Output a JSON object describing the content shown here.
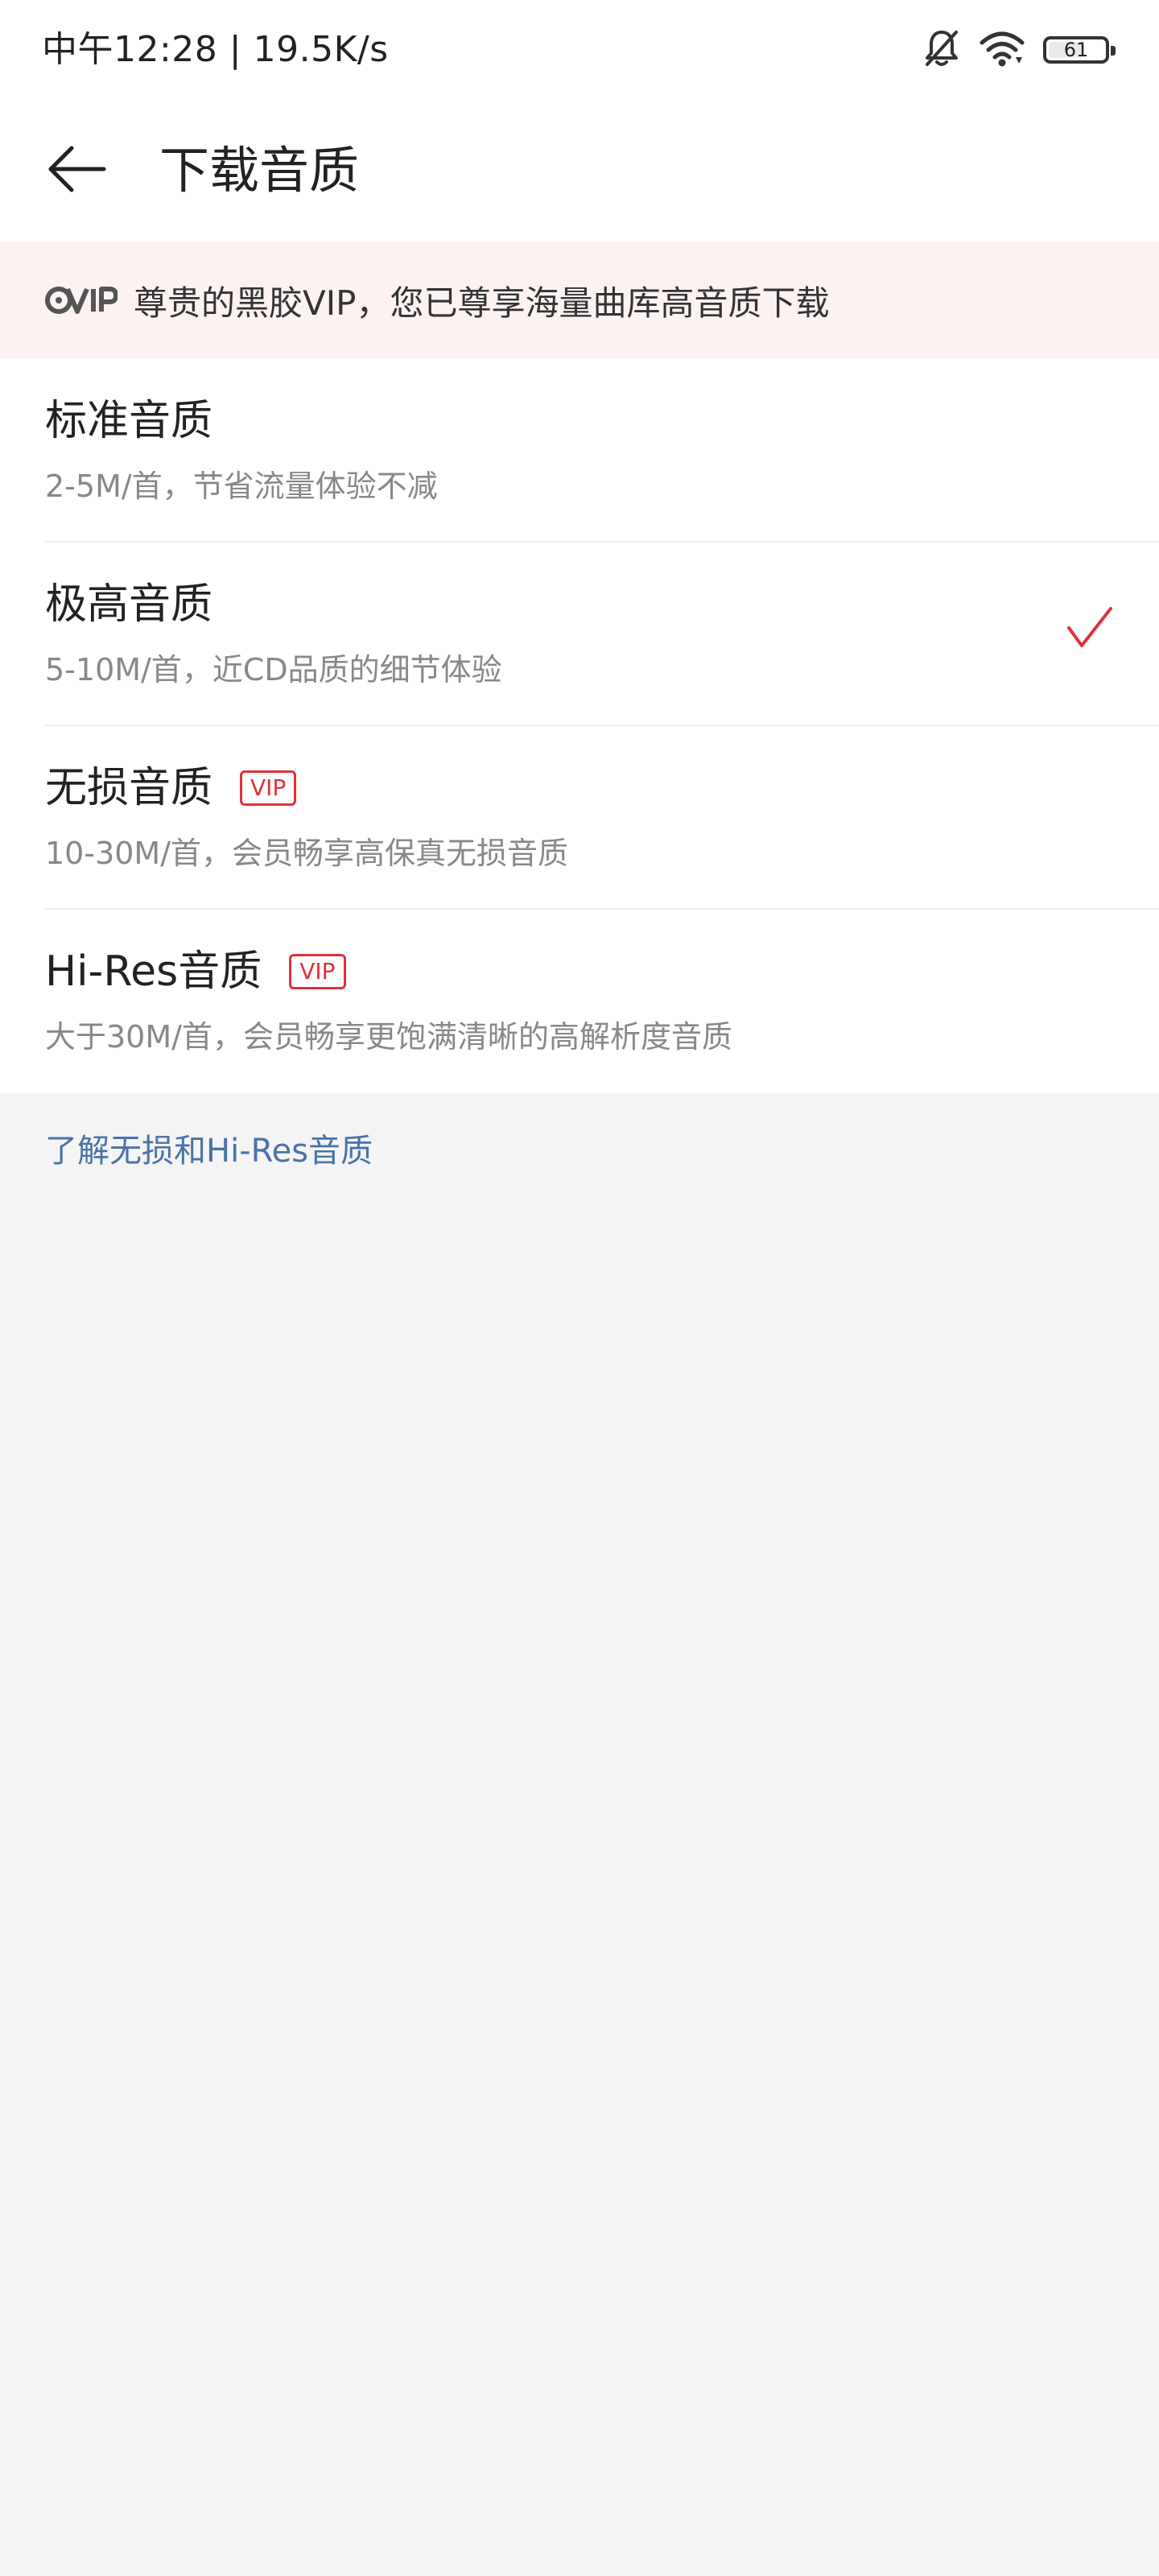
{
  "status_bar": {
    "time_speed": "中午12:28 | 19.5K/s",
    "battery_level": "61",
    "icons": [
      "bell-off-icon",
      "wifi-icon",
      "battery-icon"
    ]
  },
  "header": {
    "title": "下载音质",
    "back_icon": "arrow-left-icon"
  },
  "vip_banner": {
    "logo_text": "VIP",
    "text": "尊贵的黑胶VIP，您已尊享海量曲库高音质下载"
  },
  "options": [
    {
      "title": "标准音质",
      "desc": "2-5M/首，节省流量体验不减",
      "vip": false,
      "selected": false
    },
    {
      "title": "极高音质",
      "desc": "5-10M/首，近CD品质的细节体验",
      "vip": false,
      "selected": true
    },
    {
      "title": "无损音质",
      "desc": "10-30M/首，会员畅享高保真无损音质",
      "vip": true,
      "vip_label": "VIP",
      "selected": false
    },
    {
      "title": "Hi-Res音质",
      "desc": "大于30M/首，会员畅享更饱满清晰的高解析度音质",
      "vip": true,
      "vip_label": "VIP",
      "selected": false
    }
  ],
  "learn_more": "了解无损和Hi-Res音质",
  "colors": {
    "accent_red": "#e0313a",
    "link_blue": "#4a73a6",
    "banner_bg": "#fdf2f2",
    "page_bg": "#f4f4f4"
  }
}
